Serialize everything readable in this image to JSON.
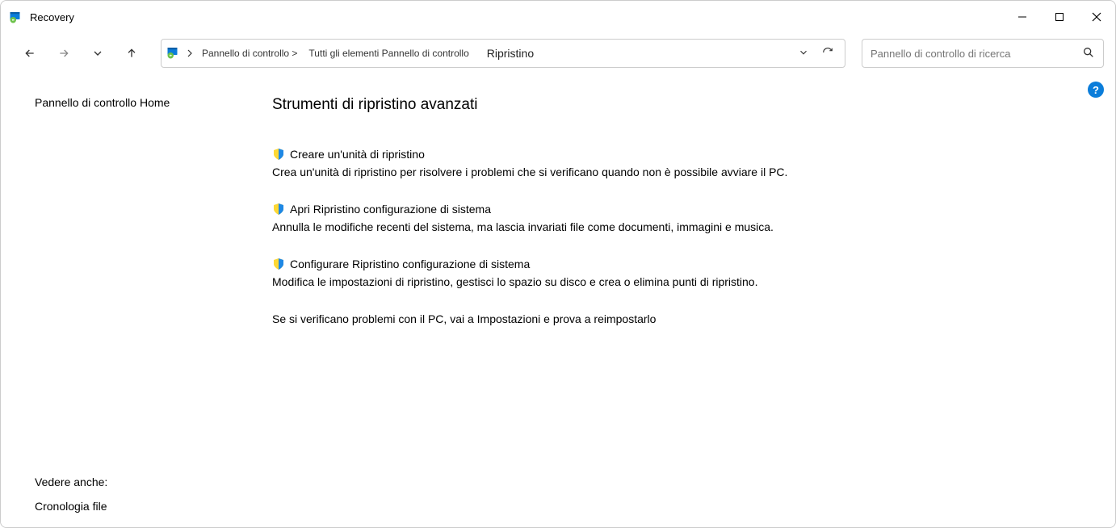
{
  "window": {
    "title": "Recovery"
  },
  "breadcrumb": {
    "part1": "Pannello di controllo >",
    "part2": "Tutti gli elementi Pannello di controllo",
    "current": "Ripristino"
  },
  "search": {
    "placeholder": "Pannello di controllo di ricerca"
  },
  "sidebar": {
    "home": "Pannello di controllo Home",
    "see_also_title": "Vedere anche:",
    "see_also_link": "Cronologia file"
  },
  "main": {
    "heading": "Strumenti di ripristino avanzati",
    "tools": [
      {
        "title": "Creare un'unità di ripristino",
        "desc": "Crea un'unità di ripristino per risolvere i problemi che si verificano quando non è possibile avviare il PC."
      },
      {
        "title": "Apri Ripristino configurazione di sistema",
        "desc": "Annulla le modifiche recenti del sistema, ma lascia invariati file come documenti, immagini e musica."
      },
      {
        "title": "Configurare Ripristino configurazione di sistema",
        "desc": "Modifica le impostazioni di ripristino, gestisci lo spazio su disco e crea o elimina punti di ripristino."
      }
    ],
    "note": "Se si verificano problemi con il PC, vai a Impostazioni e prova a reimpostarlo"
  },
  "help": "?"
}
